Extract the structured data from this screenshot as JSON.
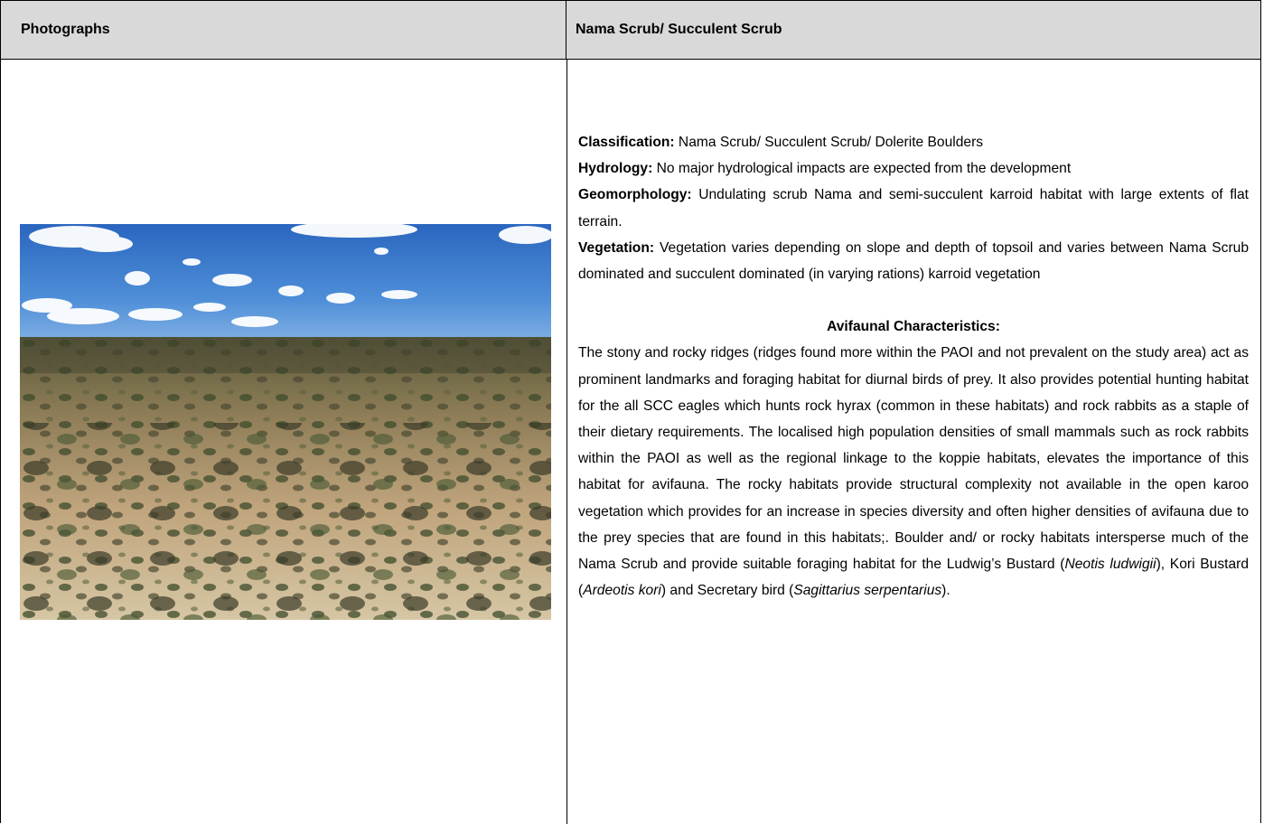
{
  "table": {
    "header": {
      "col1": "Photographs",
      "col2": "Nama Scrub/ Succulent Scrub"
    }
  },
  "photo": {
    "alt": "Nama Scrub habitat photograph"
  },
  "fields": {
    "classification_label": "Classification:",
    "classification_value": " Nama Scrub/ Succulent Scrub/ Dolerite Boulders",
    "hydrology_label": "Hydrology:",
    "hydrology_value": " No major hydrological impacts are expected from the development",
    "geomorphology_label": "Geomorphology:",
    "geomorphology_value": " Undulating scrub Nama and semi-succulent karroid habitat with large extents of flat terrain.",
    "vegetation_label": "Vegetation:",
    "vegetation_value": " Vegetation varies depending on slope and depth of topsoil and varies between Nama Scrub dominated and succulent dominated (in varying rations) karroid vegetation"
  },
  "avifauna": {
    "heading": "Avifaunal Characteristics:",
    "body_main": "The stony and rocky ridges (ridges found more within the PAOI and not prevalent on the study area) act as prominent landmarks and foraging habitat for diurnal birds of prey. It also provides potential hunting habitat for the all SCC eagles which hunts rock hyrax (common in these habitats) and rock rabbits as a staple of their dietary requirements.  The localised high population densities of small mammals such as rock rabbits within the PAOI as well as the regional linkage to the koppie habitats, elevates the importance of this habitat for avifauna. The rocky habitats provide structural complexity not available in the open karoo vegetation which provides for an increase in species diversity and often higher densities of avifauna due to the prey species that are found in this habitats;. Boulder and/ or rocky habitats intersperse much of the Nama Scrub and provide suitable foraging habitat for the Ludwig’s Bustard (",
    "species_1": "Neotis ludwigii",
    "join_1": "), Kori Bustard (",
    "species_2": "Ardeotis kori",
    "join_2": ") and Secretary bird (",
    "species_3": "Sagittarius serpentarius",
    "end": ")."
  },
  "colors": {
    "header_bg": "#d9d9d9",
    "border": "#000000",
    "sky_top": "#2f6fc4",
    "ground": "#c9b08a"
  }
}
